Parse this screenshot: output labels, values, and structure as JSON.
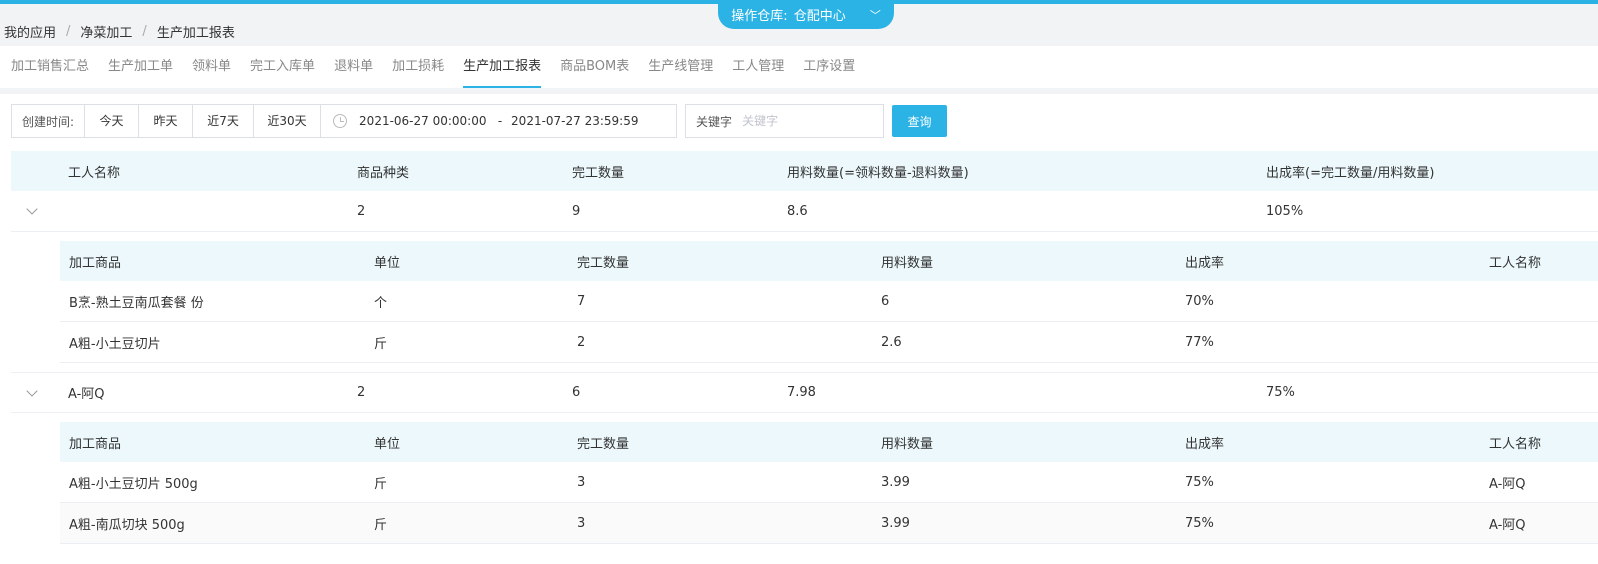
{
  "warehouse": {
    "label": "操作仓库:",
    "value": "仓配中心"
  },
  "breadcrumb": [
    "我的应用",
    "净菜加工",
    "生产加工报表"
  ],
  "tabs": [
    {
      "label": "加工销售汇总",
      "active": false
    },
    {
      "label": "生产加工单",
      "active": false
    },
    {
      "label": "领料单",
      "active": false
    },
    {
      "label": "完工入库单",
      "active": false
    },
    {
      "label": "退料单",
      "active": false
    },
    {
      "label": "加工损耗",
      "active": false
    },
    {
      "label": "生产加工报表",
      "active": true
    },
    {
      "label": "商品BOM表",
      "active": false
    },
    {
      "label": "生产线管理",
      "active": false
    },
    {
      "label": "工人管理",
      "active": false
    },
    {
      "label": "工序设置",
      "active": false
    }
  ],
  "filter": {
    "created_label": "创建时间:",
    "quick": [
      "今天",
      "昨天",
      "近7天",
      "近30天"
    ],
    "date_start": "2021-06-27 00:00:00",
    "date_sep": "-",
    "date_end": "2021-07-27 23:59:59",
    "keyword_label": "关键字",
    "keyword_placeholder": "关键字",
    "search_label": "查询"
  },
  "table": {
    "headers": [
      "工人名称",
      "商品种类",
      "完工数量",
      "用料数量(=领料数量-退料数量)",
      "出成率(=完工数量/用料数量)"
    ],
    "sub_headers": [
      "加工商品",
      "单位",
      "完工数量",
      "用料数量",
      "出成率",
      "工人名称"
    ],
    "groups": [
      {
        "worker": "",
        "kinds": "2",
        "done": "9",
        "used": "8.6",
        "rate": "105%",
        "items": [
          {
            "product": "B烹-熟土豆南瓜套餐 份",
            "unit": "个",
            "done": "7",
            "used": "6",
            "rate": "70%",
            "worker": ""
          },
          {
            "product": "A粗-小土豆切片",
            "unit": "斤",
            "done": "2",
            "used": "2.6",
            "rate": "77%",
            "worker": ""
          }
        ]
      },
      {
        "worker": "A-阿Q",
        "kinds": "2",
        "done": "6",
        "used": "7.98",
        "rate": "75%",
        "items": [
          {
            "product": "A粗-小土豆切片 500g",
            "unit": "斤",
            "done": "3",
            "used": "3.99",
            "rate": "75%",
            "worker": "A-阿Q"
          },
          {
            "product": "A粗-南瓜切块 500g",
            "unit": "斤",
            "done": "3",
            "used": "3.99",
            "rate": "75%",
            "worker": "A-阿Q"
          }
        ]
      }
    ]
  }
}
